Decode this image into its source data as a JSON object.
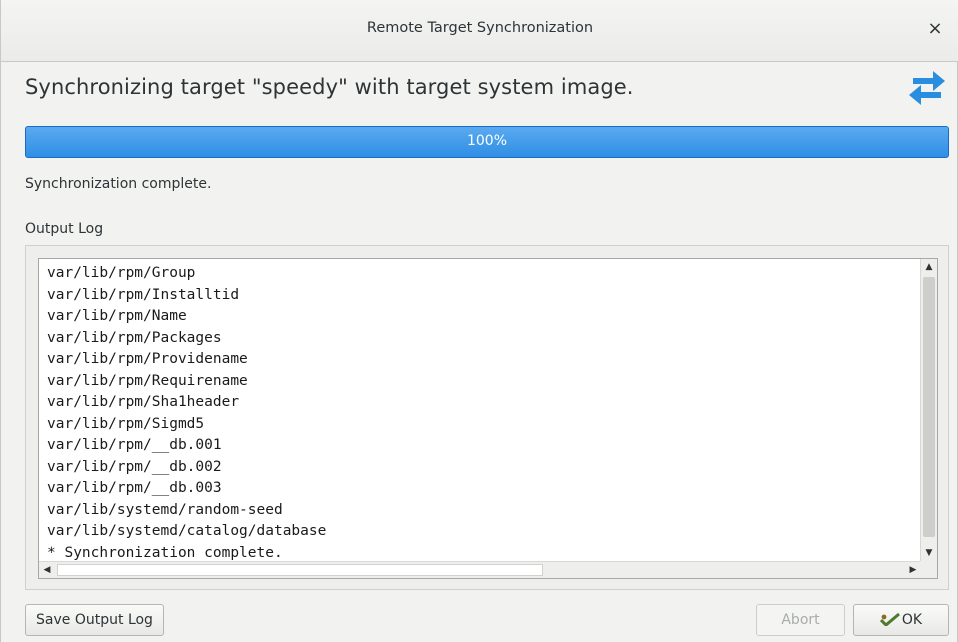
{
  "window": {
    "title": "Remote Target Synchronization",
    "close_glyph": "×"
  },
  "header": {
    "message": "Synchronizing target \"speedy\" with target system image.",
    "icon": "sync-arrows-icon",
    "icon_color": "#2a8ee0"
  },
  "progress": {
    "value_percent": 100,
    "label": "100%",
    "bar_color": "#3a93e6"
  },
  "status": {
    "text": "Synchronization complete."
  },
  "log": {
    "label": "Output Log",
    "lines": [
      "var/lib/rpm/Group",
      "var/lib/rpm/Installtid",
      "var/lib/rpm/Name",
      "var/lib/rpm/Packages",
      "var/lib/rpm/Providename",
      "var/lib/rpm/Requirename",
      "var/lib/rpm/Sha1header",
      "var/lib/rpm/Sigmd5",
      "var/lib/rpm/__db.001",
      "var/lib/rpm/__db.002",
      "var/lib/rpm/__db.003",
      "var/lib/systemd/random-seed",
      "var/lib/systemd/catalog/database",
      "* Synchronization complete."
    ]
  },
  "buttons": {
    "save_log": "Save Output Log",
    "abort": "Abort",
    "ok": "OK",
    "ok_icon": "ok-checkmark-icon"
  }
}
